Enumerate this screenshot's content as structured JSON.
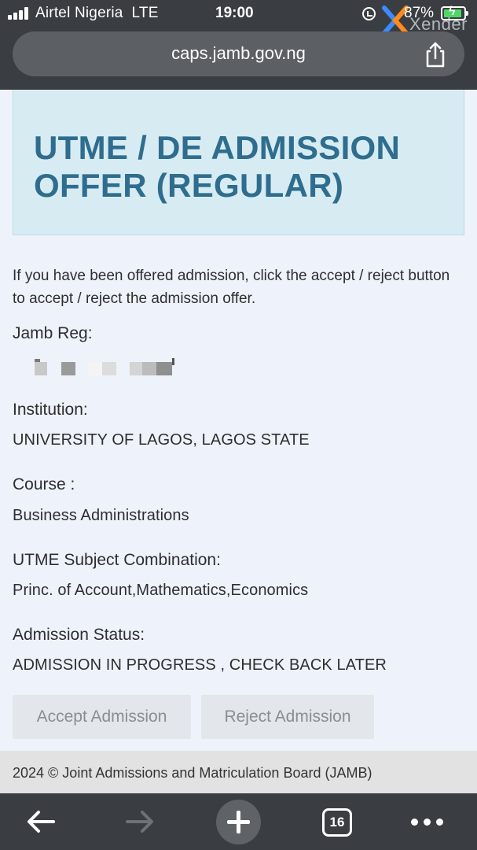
{
  "status_bar": {
    "carrier": "Airtel Nigeria",
    "network": "LTE",
    "time": "19:00",
    "battery": "87%",
    "overlay_app": "Xender"
  },
  "browser": {
    "url": "caps.jamb.gov.ng",
    "tab_count": "16"
  },
  "page": {
    "title": "UTME / DE ADMISSION OFFER (REGULAR)",
    "intro": "If you have been offered admission, click the accept / reject button to accept / reject the admission offer.",
    "fields": {
      "reg_label": "Jamb Reg:",
      "institution_label": "Institution:",
      "institution_value": "UNIVERSITY OF LAGOS, LAGOS STATE",
      "course_label": "Course :",
      "course_value": "Business Administrations",
      "subjects_label": "UTME Subject Combination:",
      "subjects_value": "Princ. of Account,Mathematics,Economics",
      "status_label": "Admission Status:",
      "status_value": "ADMISSION IN PROGRESS , CHECK BACK LATER"
    },
    "buttons": {
      "accept": "Accept Admission",
      "reject": "Reject Admission"
    },
    "footer": "2024 © Joint Admissions and Matriculation Board (JAMB)"
  },
  "colors": {
    "title": "#2f6d8e",
    "title_box": "#d7ebf3",
    "page_bg": "#eef2fa",
    "browser_chrome": "#3a3d41"
  },
  "icons": {
    "back": "arrow-left-icon",
    "forward": "arrow-right-icon",
    "new_tab": "plus-icon",
    "tabs": "tabs-icon",
    "more": "more-icon",
    "share": "share-icon"
  }
}
